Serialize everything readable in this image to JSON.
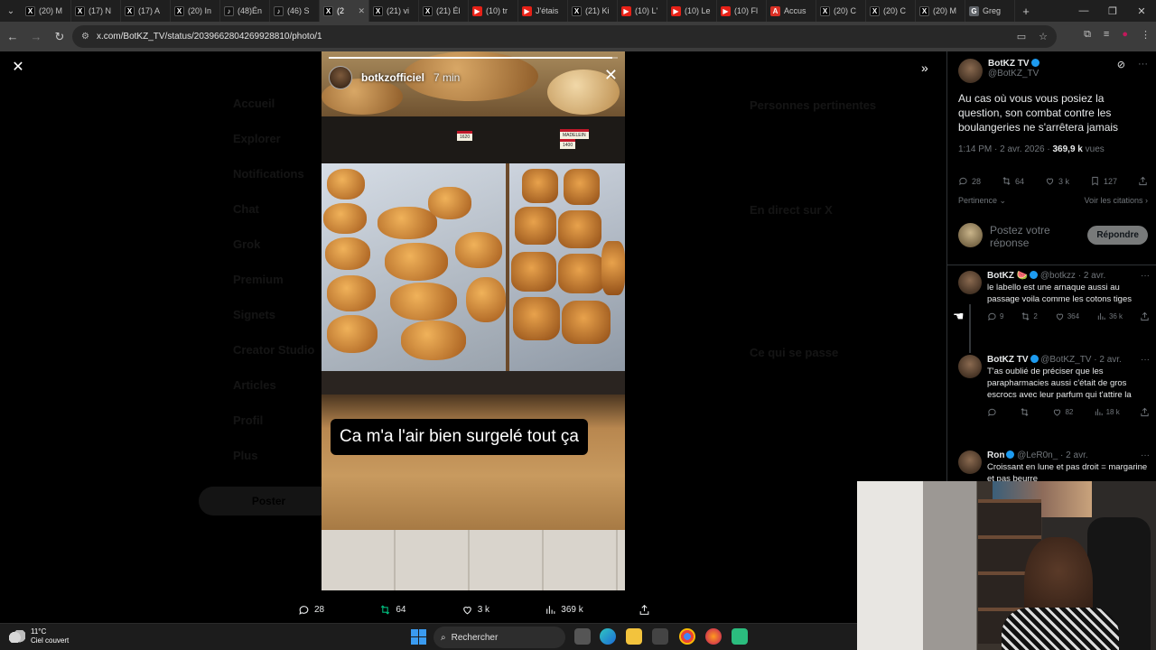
{
  "browser": {
    "tabs": [
      {
        "label": "(20) M",
        "icon": "x"
      },
      {
        "label": "(17) N",
        "icon": "x"
      },
      {
        "label": "(17) A",
        "icon": "x"
      },
      {
        "label": "(20) In",
        "icon": "x"
      },
      {
        "label": "(48)Én",
        "icon": "tiktok"
      },
      {
        "label": "(46) S",
        "icon": "tiktok"
      },
      {
        "label": "(2",
        "icon": "x",
        "active": true
      },
      {
        "label": "(21) vi",
        "icon": "x"
      },
      {
        "label": "(21) Él",
        "icon": "x"
      },
      {
        "label": "(10) tr",
        "icon": "youtube"
      },
      {
        "label": "J'étais",
        "icon": "youtube"
      },
      {
        "label": "(21) Ki",
        "icon": "x"
      },
      {
        "label": "(10) L'",
        "icon": "youtube"
      },
      {
        "label": "(10) Le",
        "icon": "youtube"
      },
      {
        "label": "(10) Fl",
        "icon": "youtube"
      },
      {
        "label": "Accus",
        "icon": "news"
      },
      {
        "label": "(20) C",
        "icon": "x"
      },
      {
        "label": "(20) C",
        "icon": "x"
      },
      {
        "label": "(20) M",
        "icon": "x"
      },
      {
        "label": "Greg",
        "icon": "chat"
      }
    ],
    "url": "x.com/BotKZ_TV/status/2039662804269928810/photo/1"
  },
  "background_ui": {
    "nav": [
      "Accueil",
      "Explorer",
      "Notifications",
      "Chat",
      "Grok",
      "Premium",
      "Signets",
      "Creator Studio",
      "Articles",
      "Profil",
      "Plus"
    ],
    "post_button": "Poster",
    "right_headings": [
      "Personnes pertinentes",
      "En direct sur X",
      "Ce qui se passe"
    ]
  },
  "story": {
    "username": "botkzofficiel",
    "time": "7 min",
    "caption": "Ca m'a l'air bien surgelé tout ça",
    "progress": 0.98,
    "price_labels": [
      "MADELEIN",
      "1400",
      "1620"
    ]
  },
  "viewer_actions": {
    "replies": "28",
    "reposts": "64",
    "likes": "3 k",
    "views": "369 k"
  },
  "tweet": {
    "author_name": "BotKZ TV",
    "author_handle": "@BotKZ_TV",
    "text": "Au cas où vous vous posiez la question, son combat contre les boulangeries ne s'arrêtera jamais",
    "time": "1:14 PM · 2 avr. 2026 · ",
    "views_count": "369,9 k",
    "views_label": " vues",
    "stats": {
      "replies": "28",
      "reposts": "64",
      "likes": "3 k",
      "bookmarks": "127"
    },
    "sort_label": "Pertinence ⌄",
    "quotes_label": "Voir les citations ›",
    "compose_placeholder": "Postez votre réponse",
    "reply_button": "Répondre"
  },
  "replies": [
    {
      "name": "BotKZ 🍉",
      "handle": "@botkzz · 2 avr.",
      "text": "le labello est une arnaque aussi au passage voila comme les cotons tiges",
      "stats": {
        "replies": "9",
        "reposts": "2",
        "likes": "364",
        "views": "36 k"
      }
    },
    {
      "name": "BotKZ TV",
      "handle": "@BotKZ_TV · 2 avr.",
      "text": "T'as oublié de préciser que les parapharmacies aussi c'était de gros escrocs avec leur parfum qui t'attire la",
      "stats": {
        "replies": "",
        "reposts": "",
        "likes": "82",
        "views": "18 k"
      }
    },
    {
      "name": "Ron",
      "handle": "@LeR0n_ · 2 avr.",
      "text": "Croissant en lune et pas droit = margarine et pas beurre",
      "stats": {
        "replies": "",
        "reposts": "",
        "likes": "",
        "views": ""
      }
    }
  ],
  "taskbar": {
    "temperature": "11°C",
    "weather": "Ciel couvert",
    "search_label": "Rechercher"
  }
}
